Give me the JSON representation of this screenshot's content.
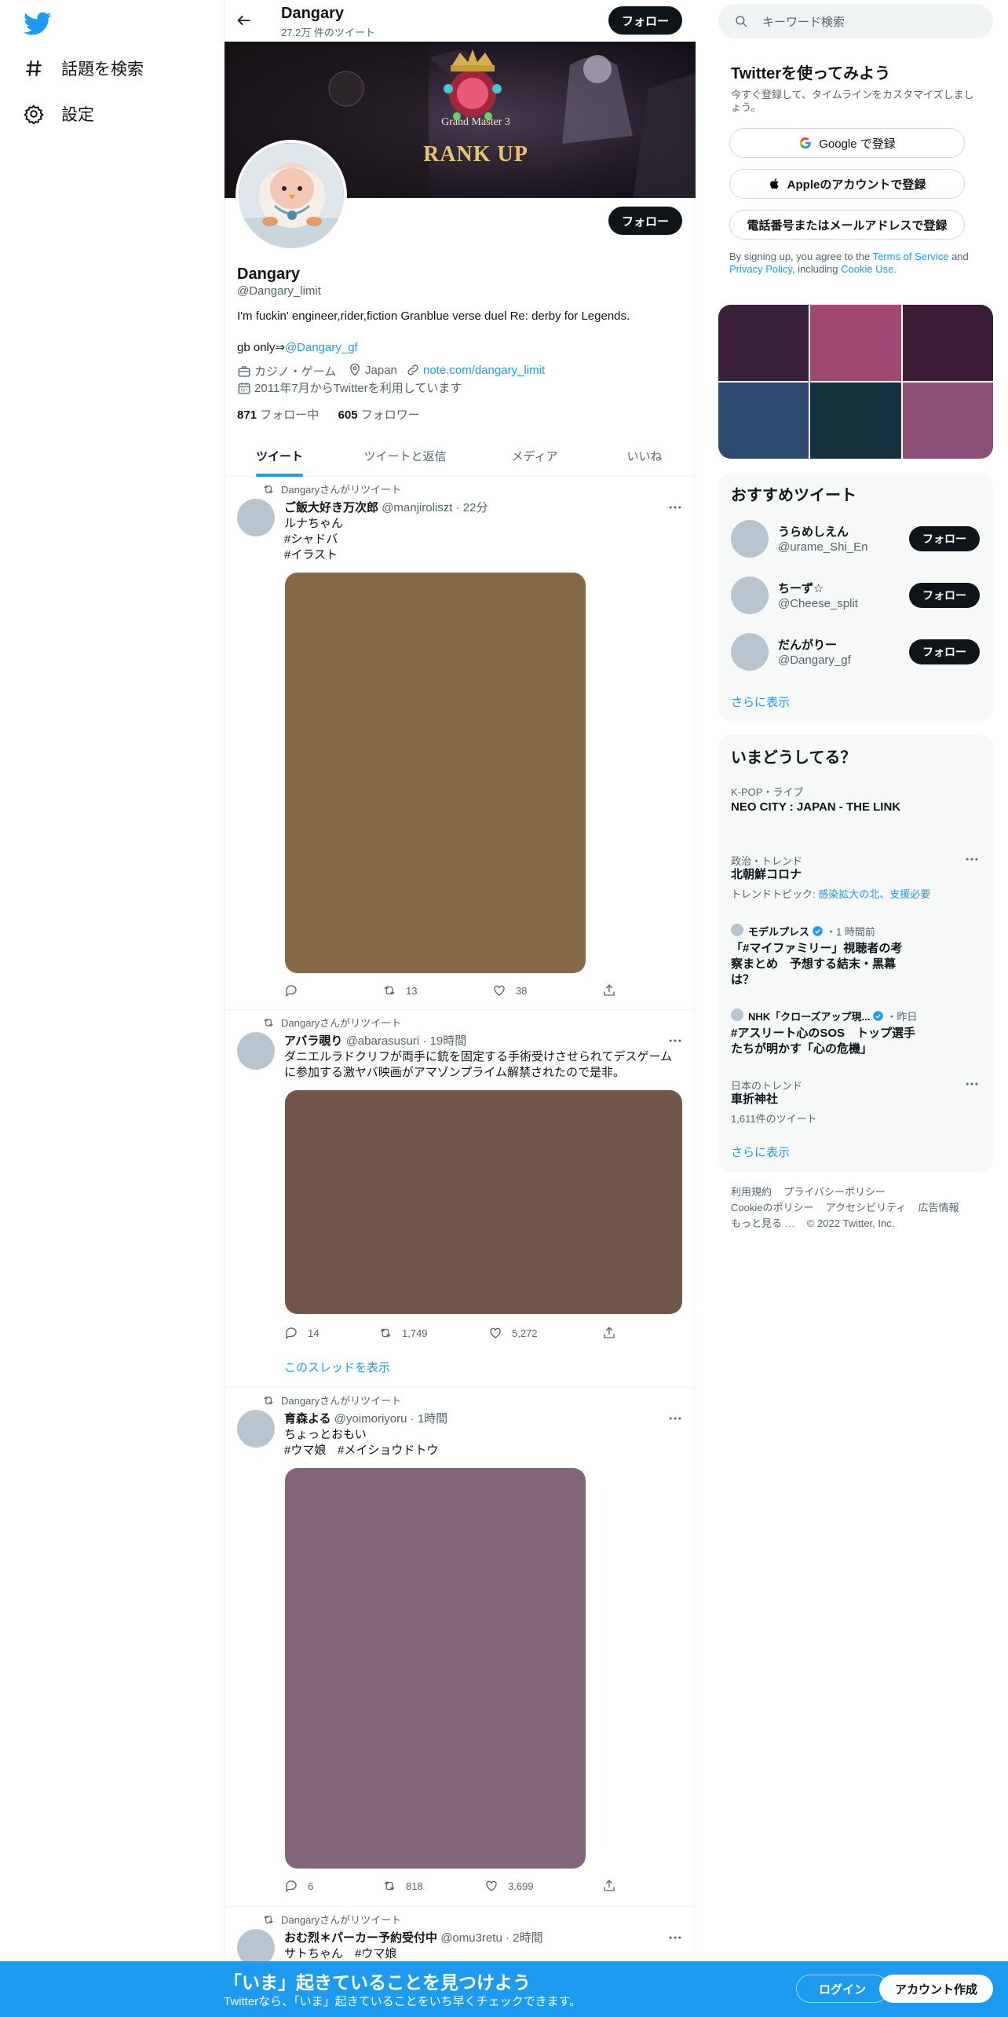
{
  "nav": {
    "items": [
      {
        "label": "話題を検索",
        "icon": "hashtag-icon"
      },
      {
        "label": "設定",
        "icon": "gear-icon"
      }
    ]
  },
  "header": {
    "name": "Dangary",
    "tweet_count": "27.2万 件のツイート",
    "follow_label": "フォロー"
  },
  "profile": {
    "name": "Dangary",
    "handle": "@Dangary_limit",
    "follow_label": "フォロー",
    "bio": "I'm fuckin' engineer,rider,fiction Granblue verse duel Re: derby for Legends.",
    "bio2_prefix": "gb only⇒",
    "bio2_link": "@Dangary_gf",
    "category": "カジノ・ゲーム",
    "location": "Japan",
    "website": "note.com/dangary_limit",
    "joined": "2011年7月からTwitterを利用しています",
    "following_count": "871",
    "following_label": "フォロー中",
    "followers_count": "605",
    "followers_label": "フォロワー",
    "banner_text_1": "Grand Master 3",
    "banner_text_2": "RANK UP"
  },
  "tabs": [
    "ツイート",
    "ツイートと返信",
    "メディア",
    "いいね"
  ],
  "tweets": [
    {
      "retweet_label": "Dangaryさんがリツイート",
      "name": "ご飯大好き万次郎",
      "handle": "@manjiroliszt",
      "time": "22分",
      "text": "ルナちゃん",
      "tags": [
        "#シャドバ",
        "#イラスト"
      ],
      "media_color": "#876847",
      "replies": "",
      "retweets": "13",
      "likes": "38"
    },
    {
      "retweet_label": "Dangaryさんがリツイート",
      "name": "アバラ覗り",
      "handle": "@abarasusuri",
      "time": "19時間",
      "text": "ダニエルラドクリフが両手に銃を固定する手術受けさせられてデスゲームに参加する激ヤバ映画がアマゾンプライム解禁されたので是非。",
      "media_color": "#73564a",
      "replies": "14",
      "retweets": "1,749",
      "likes": "5,272",
      "thread_label": "このスレッドを表示"
    },
    {
      "retweet_label": "Dangaryさんがリツイート",
      "name": "育森よる",
      "handle": "@yoimoriyoru",
      "time": "1時間",
      "text": "ちょっとおもい",
      "tags": [
        "#ウマ娘",
        "#メイショウドトウ"
      ],
      "media_color": "#84667c",
      "replies": "6",
      "retweets": "818",
      "likes": "3,699"
    },
    {
      "retweet_label": "Dangaryさんがリツイート",
      "name": "おむ烈＊パーカー予約受付中",
      "handle": "@omu3retu",
      "time": "2時間",
      "text": "サトちゃん",
      "tags": [
        "#ウマ娘"
      ]
    }
  ],
  "search": {
    "placeholder": "キーワード検索"
  },
  "signup": {
    "title": "Twitterを使ってみよう",
    "subtitle": "今すぐ登録して、タイムラインをカスタマイズしましょう。",
    "google_label": "Google で登録",
    "apple_label": "Appleのアカウントで登録",
    "phone_label": "電話番号またはメールアドレスで登録",
    "terms_prefix": "By signing up, you agree to the",
    "terms_link": "Terms of Service",
    "terms_and": "and",
    "privacy_link": "Privacy Policy",
    "terms_including": ", including",
    "cookie_link": "Cookie Use",
    "terms_end": "."
  },
  "mosaic_colors": [
    "#3a1f3a",
    "#a04772",
    "#3a1c36",
    "#2f4a70",
    "#13323e",
    "#8d4f77"
  ],
  "recommend": {
    "title": "おすすめツイート",
    "users": [
      {
        "name": "うらめしえん",
        "handle": "@urame_Shi_En",
        "follow": "フォロー"
      },
      {
        "name": "ちーず☆",
        "handle": "@Cheese_split",
        "follow": "フォロー"
      },
      {
        "name": "だんがりー",
        "handle": "@Dangary_gf",
        "follow": "フォロー"
      }
    ],
    "more": "さらに表示"
  },
  "trends": {
    "title": "いまどうしてる？",
    "items": [
      {
        "meta": "K-POP・ライブ",
        "name": "NEO CITY : JAPAN - THE LINK"
      },
      {
        "meta": "政治・トレンド",
        "name": "北朝鮮コロナ",
        "topic_prefix": "トレンドトピック: ",
        "topic": "感染拡大の北、支援必要"
      },
      {
        "source": "モデルプレス",
        "time": "・1 時間前",
        "name": "「#マイファミリー」視聴者の考察まとめ　予想する結末・黒幕は？"
      },
      {
        "source": "NHK「クローズアップ現...",
        "time": "・昨日",
        "name": "#アスリート心のSOS　トップ選手たちが明かす「心の危機」"
      },
      {
        "meta": "日本のトレンド",
        "name": "車折神社",
        "count": "1,611件のツイート"
      }
    ],
    "more": "さらに表示"
  },
  "footer": {
    "terms": "利用規約",
    "privacy": "プライバシーポリシー",
    "cookie": "Cookieのポリシー",
    "accessibility": "アクセシビリティ",
    "ads": "広告情報",
    "more": "もっと見る …",
    "copyright": "© 2022 Twitter, Inc."
  },
  "bottom_bar": {
    "title": "「いま」起きていることを見つけよう",
    "subtitle": "Twitterなら、「いま」起きていることをいち早くチェックできます。",
    "login": "ログイン",
    "signup": "アカウント作成"
  },
  "colors": {
    "accent": "#1d9bf0",
    "dark": "#0f1419",
    "muted": "#536471"
  }
}
